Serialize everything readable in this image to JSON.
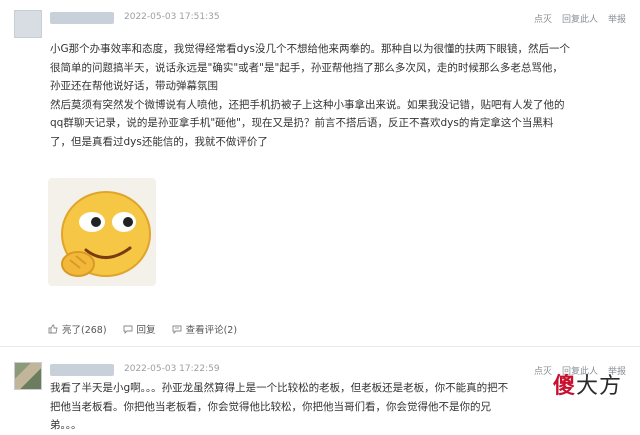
{
  "comments": [
    {
      "timestamp": "2022-05-03 17:51:35",
      "actions": {
        "like_alt": "点灭",
        "reply_label": "回复此人",
        "report": "举报"
      },
      "paragraphs": [
        "小G那个办事效率和态度，我觉得经常看dys没几个不想给他来两拳的。那种自以为很懂的扶两下眼镜，然后一个很简单的问题搞半天，说话永远是\"确实\"或者\"是\"起手，孙亚帮他挡了那么多次风，走的时候那么多老总骂他，孙亚还在帮他说好话，带动弹幕氛围",
        "然后莫须有突然发个微博说有人喷他，还把手机扔被子上这种小事拿出来说。如果我没记错，贴吧有人发了他的qq群聊天记录，说的是孙亚拿手机\"砸他\"，现在又是扔？前言不搭后语，反正不喜欢dys的肯定拿这个当黑料了，但是真看过dys还能信的，我就不做评价了"
      ],
      "toolbar": {
        "like": "亮了(268)",
        "reply": "回复",
        "view_replies": "查看评论(2)"
      }
    },
    {
      "timestamp": "2022-05-03 17:22:59",
      "actions": {
        "like_alt": "点灭",
        "reply_label": "回复此人",
        "report": "举报"
      },
      "paragraphs": [
        "我看了半天是小g啊。。。孙亚龙虽然算得上是一个比较松的老板，但老板还是老板，你不能真的把不把他当老板看。你把他当老板看，你会觉得他比较松，你把他当哥们看，你会觉得他不是你的兄弟。。。"
      ]
    }
  ],
  "watermark": {
    "first": "傻",
    "rest": "大方"
  },
  "colors": {
    "accent": "#c8102e",
    "meta": "#9aa0a6"
  },
  "icons": [
    "smiley-sticker",
    "like-icon",
    "reply-icon",
    "comment-icon"
  ]
}
